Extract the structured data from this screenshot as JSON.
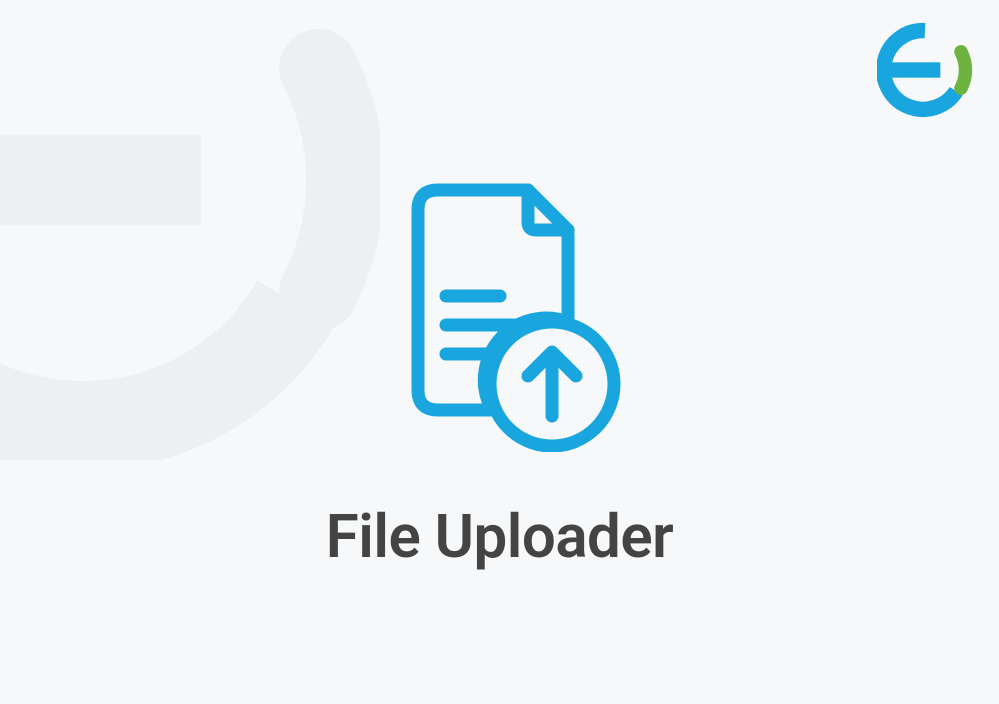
{
  "page": {
    "title": "File Uploader"
  },
  "colors": {
    "primary": "#19a6de",
    "accent": "#6eb33f",
    "text": "#444444",
    "background": "#f7f8f9"
  },
  "icons": {
    "logo": "eq-logo",
    "main": "file-upload-icon"
  }
}
